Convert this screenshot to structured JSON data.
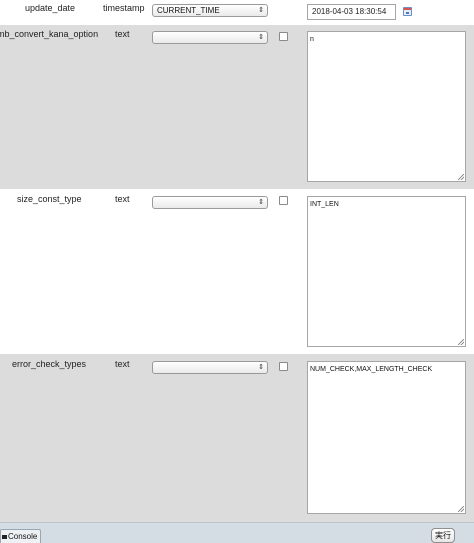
{
  "rows": [
    {
      "name": "update_date",
      "type": "timestamp",
      "function_select": "CURRENT_TIME",
      "value": "2018-04-03 18:30:54"
    },
    {
      "name": "mb_convert_kana_option",
      "type": "text",
      "function_select": "",
      "value": "n"
    },
    {
      "name": "size_const_type",
      "type": "text",
      "function_select": "",
      "value": "INT_LEN"
    },
    {
      "name": "error_check_types",
      "type": "text",
      "function_select": "",
      "value": "NUM_CHECK,MAX_LENGTH_CHECK"
    }
  ],
  "bottombar": {
    "console_label": "Console",
    "execute_label": "実行"
  },
  "icons": {
    "select_arrow": "select-arrow-icon",
    "calendar": "calendar-icon",
    "console": "console-icon"
  }
}
